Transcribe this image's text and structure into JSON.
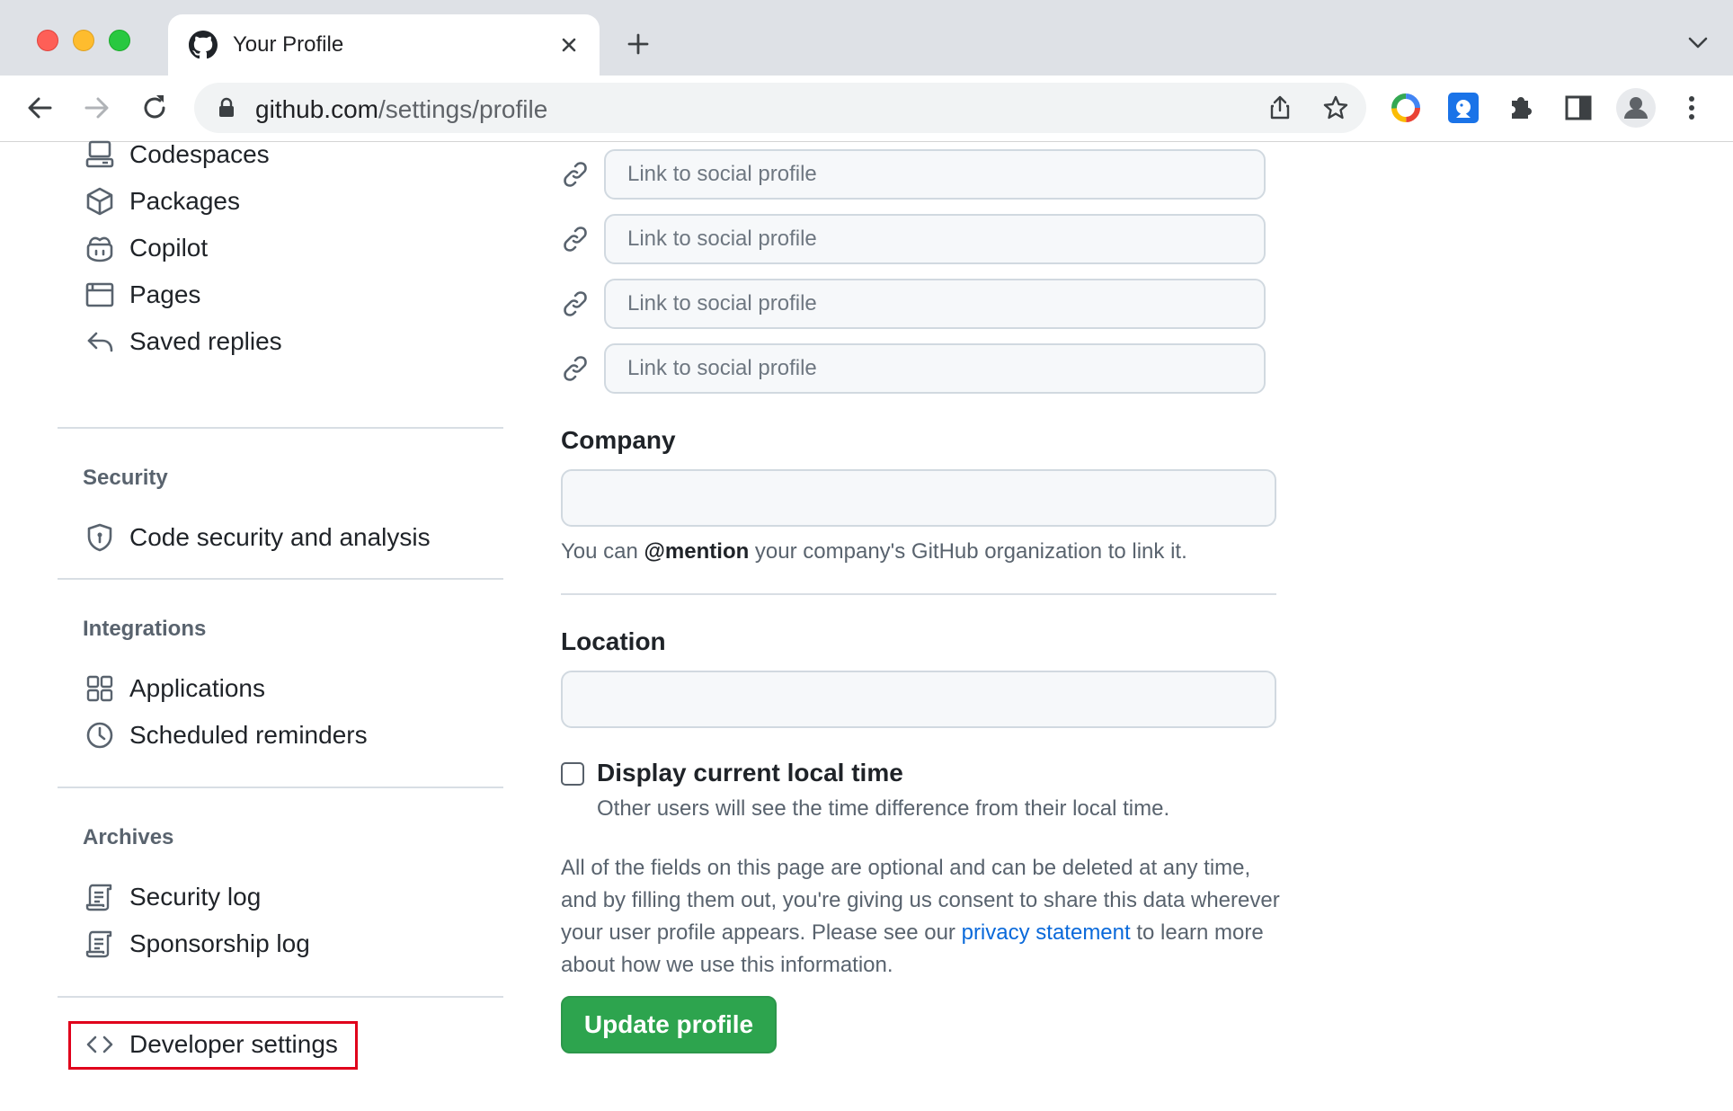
{
  "browser": {
    "tab": {
      "title": "Your Profile",
      "favicon": "github-icon"
    },
    "url": {
      "host": "github.com",
      "path": "/settings/profile"
    }
  },
  "sidebar": {
    "items_top": [
      {
        "label": "Codespaces",
        "icon": "codespaces-icon"
      },
      {
        "label": "Packages",
        "icon": "package-icon"
      },
      {
        "label": "Copilot",
        "icon": "copilot-icon"
      },
      {
        "label": "Pages",
        "icon": "browser-icon"
      },
      {
        "label": "Saved replies",
        "icon": "reply-icon"
      }
    ],
    "sections": [
      {
        "heading": "Security",
        "items": [
          {
            "label": "Code security and analysis",
            "icon": "shield-icon"
          }
        ]
      },
      {
        "heading": "Integrations",
        "items": [
          {
            "label": "Applications",
            "icon": "apps-icon"
          },
          {
            "label": "Scheduled reminders",
            "icon": "clock-icon"
          }
        ]
      },
      {
        "heading": "Archives",
        "items": [
          {
            "label": "Security log",
            "icon": "log-icon"
          },
          {
            "label": "Sponsorship log",
            "icon": "log-icon"
          }
        ]
      }
    ],
    "developer": {
      "label": "Developer settings",
      "icon": "code-icon"
    }
  },
  "form": {
    "social_placeholder": "Link to social profile",
    "company": {
      "label": "Company",
      "value": "",
      "note_prefix": "You can ",
      "note_bold": "@mention",
      "note_suffix": " your company's GitHub organization to link it."
    },
    "location": {
      "label": "Location",
      "value": ""
    },
    "local_time": {
      "label": "Display current local time",
      "note": "Other users will see the time difference from their local time.",
      "checked": false
    },
    "disclaimer": {
      "text": "All of the fields on this page are optional and can be deleted at any time, and by filling them out, you're giving us consent to share this data wherever your user profile appears. Please see our ",
      "link": "privacy statement",
      "suffix": " to learn more about how we use this information."
    },
    "submit": "Update profile"
  },
  "colors": {
    "accent_green": "#2da44e",
    "link_blue": "#0969da",
    "highlight_red": "#e0001b"
  }
}
